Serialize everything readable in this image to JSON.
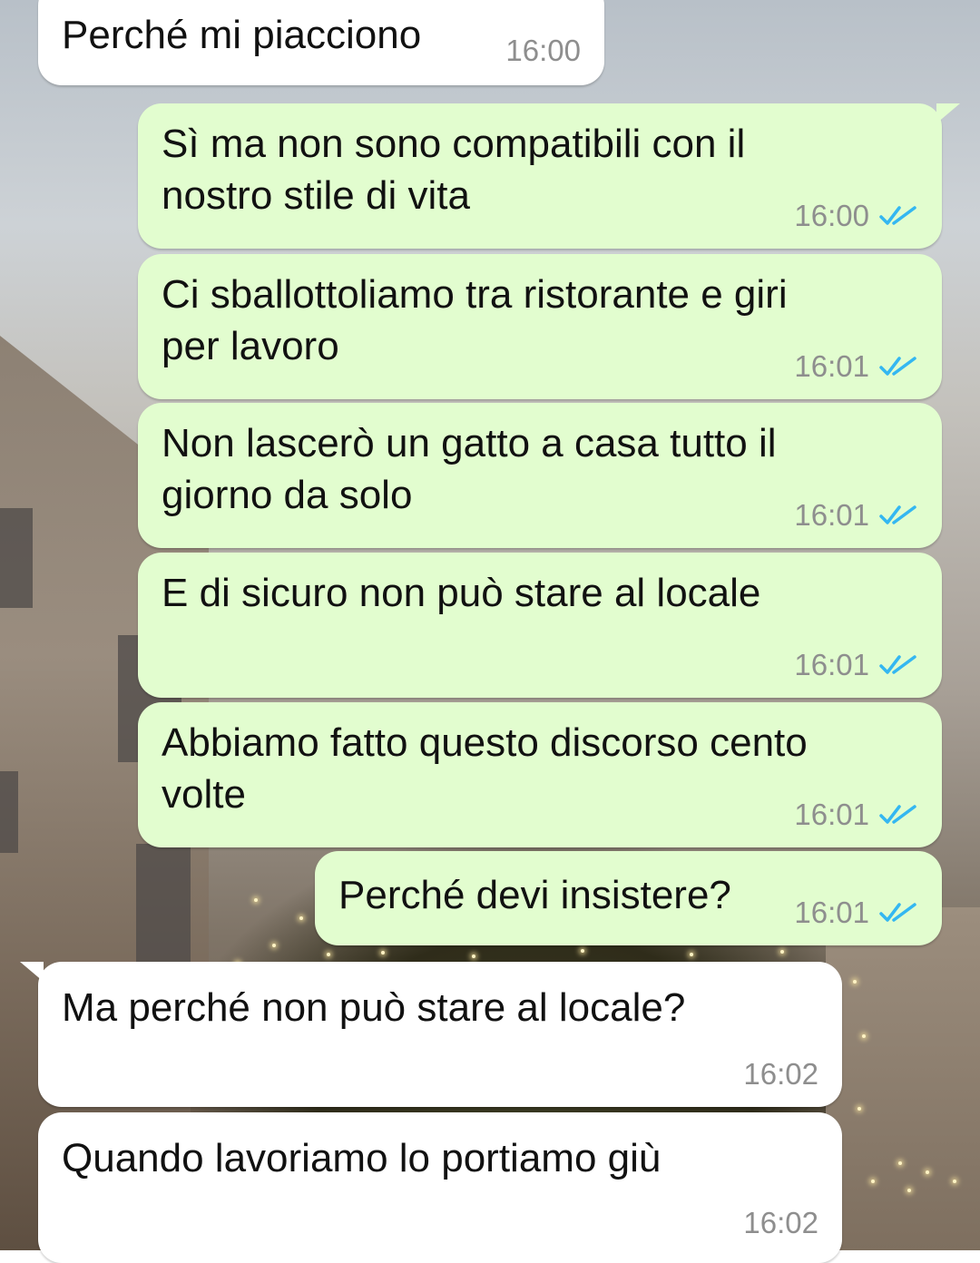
{
  "messages": [
    {
      "dir": "in",
      "text": "Perché mi piacciono",
      "time": "16:00"
    },
    {
      "dir": "out",
      "text": "Sì ma non sono compatibili con il\nnostro stile di vita",
      "time": "16:00",
      "status": "read"
    },
    {
      "dir": "out",
      "text": "Ci sballottoliamo tra ristorante e giri\nper lavoro",
      "time": "16:01",
      "status": "read"
    },
    {
      "dir": "out",
      "text": "Non lascerò un gatto a casa tutto il\ngiorno da solo",
      "time": "16:01",
      "status": "read"
    },
    {
      "dir": "out",
      "text": "E di sicuro non può stare al locale",
      "time": "16:01",
      "status": "read"
    },
    {
      "dir": "out",
      "text": "Abbiamo fatto questo discorso cento\nvolte",
      "time": "16:01",
      "status": "read"
    },
    {
      "dir": "out",
      "text": "Perché devi insistere?",
      "time": "16:01",
      "status": "read"
    },
    {
      "dir": "in",
      "text": "Ma perché non può stare al locale?",
      "time": "16:02"
    },
    {
      "dir": "in",
      "text": "Quando lavoriamo lo portiamo giù",
      "time": "16:02"
    }
  ],
  "colors": {
    "incoming_bubble": "#ffffff",
    "outgoing_bubble": "#e2fdcf",
    "read_ticks": "#34b7f1",
    "timestamp": "#8e8e8e"
  },
  "icons": {
    "read_status": "double-check-icon"
  }
}
